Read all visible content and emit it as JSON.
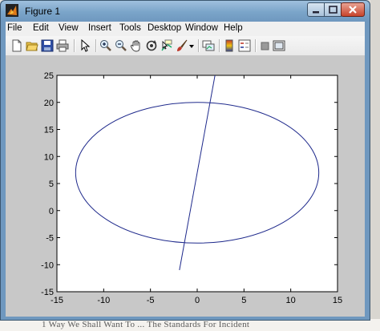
{
  "window": {
    "title": "Figure 1"
  },
  "menu": [
    {
      "label": "File"
    },
    {
      "label": "Edit"
    },
    {
      "label": "View"
    },
    {
      "label": "Insert"
    },
    {
      "label": "Tools"
    },
    {
      "label": "Desktop"
    },
    {
      "label": "Window"
    },
    {
      "label": "Help"
    }
  ],
  "toolbar": {
    "icons": [
      "new-figure-icon",
      "open-file-icon",
      "save-icon",
      "print-icon",
      "edit-plot-arrow-icon",
      "zoom-in-icon",
      "zoom-out-icon",
      "pan-icon",
      "rotate-3d-icon",
      "data-cursor-icon",
      "brush-icon",
      "brush-dropdown-icon",
      "link-plot-icon",
      "insert-colorbar-icon",
      "insert-legend-icon",
      "hide-plot-tools-icon",
      "show-plot-tools-icon"
    ]
  },
  "background_text": "1 Way We Shall Want To ... The Standards For Incident",
  "colors": {
    "line": "#1f2a8c",
    "axes_bg": "#ffffff",
    "figure_bg": "#c8c8c8"
  },
  "chart_data": {
    "type": "line",
    "title": "",
    "xlabel": "",
    "ylabel": "",
    "xlim": [
      -15,
      15
    ],
    "ylim": [
      -15,
      25
    ],
    "xticks": [
      -15,
      -10,
      -5,
      0,
      5,
      10,
      15
    ],
    "yticks": [
      -15,
      -10,
      -5,
      0,
      5,
      10,
      15,
      20,
      25
    ],
    "grid": false,
    "series": [
      {
        "kind": "ellipse",
        "center": [
          0,
          7
        ],
        "radius_x": 13,
        "radius_y": 13,
        "color": "#1f2a8c"
      },
      {
        "kind": "segment",
        "x": [
          -1.9,
          1.9
        ],
        "y": [
          -11,
          25
        ],
        "color": "#1f2a8c"
      }
    ]
  }
}
